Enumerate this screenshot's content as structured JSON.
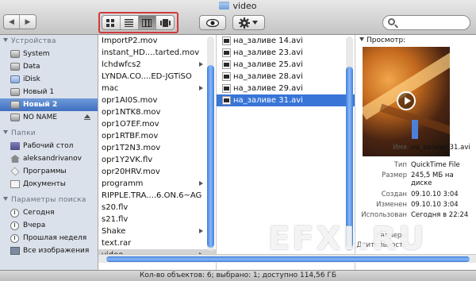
{
  "window": {
    "title": "video"
  },
  "toolbar": {
    "back": "◀",
    "forward": "▶",
    "views": [
      "icon-view",
      "list-view",
      "column-view",
      "coverflow-view"
    ],
    "active_view": "column-view"
  },
  "sidebar": {
    "sections": [
      {
        "title": "Устройства",
        "items": [
          {
            "label": "System",
            "icon": "disk-icon"
          },
          {
            "label": "Data",
            "icon": "disk-icon"
          },
          {
            "label": "iDisk",
            "icon": "idisk-icon"
          },
          {
            "label": "Новый 1",
            "icon": "disk-icon"
          },
          {
            "label": "Новый 2",
            "icon": "disk-icon",
            "selected": true
          },
          {
            "label": "NO NAME",
            "icon": "disk-icon",
            "eject": true
          }
        ]
      },
      {
        "title": "Папки",
        "items": [
          {
            "label": "Рабочий стол",
            "icon": "desktop-icon"
          },
          {
            "label": "aleksandrivanov",
            "icon": "home-icon"
          },
          {
            "label": "Программы",
            "icon": "applications-icon"
          },
          {
            "label": "Документы",
            "icon": "documents-icon"
          }
        ]
      },
      {
        "title": "Параметры поиска",
        "items": [
          {
            "label": "Сегодня",
            "icon": "clock-icon"
          },
          {
            "label": "Вчера",
            "icon": "clock-icon"
          },
          {
            "label": "Прошлая неделя",
            "icon": "clock-icon"
          },
          {
            "label": "Все изображения",
            "icon": "images-icon"
          }
        ]
      }
    ]
  },
  "column1": {
    "rows": [
      {
        "label": "ImportP2.mov"
      },
      {
        "label": "instant_HD....tarted.mov"
      },
      {
        "label": "lchdwfcs2",
        "folder": true
      },
      {
        "label": "LYNDA.CO....ED-JGTiSO"
      },
      {
        "label": "mac",
        "folder": true
      },
      {
        "label": "opr1AI0S.mov"
      },
      {
        "label": "opr1NTK8.mov"
      },
      {
        "label": "opr1O7EF.mov"
      },
      {
        "label": "opr1RTBF.mov"
      },
      {
        "label": "opr1T2N3.mov"
      },
      {
        "label": "opr1Y2VK.flv"
      },
      {
        "label": "opr20HRV.mov"
      },
      {
        "label": "programm",
        "folder": true
      },
      {
        "label": "RIPPLE.TRA....6.ON.6~AG"
      },
      {
        "label": "s20.flv"
      },
      {
        "label": "s21.flv"
      },
      {
        "label": "Shake",
        "folder": true
      },
      {
        "label": "text.rar"
      },
      {
        "label": "video",
        "folder": true,
        "highlight": true
      }
    ]
  },
  "column2": {
    "rows": [
      {
        "label": "на_заливе 14.avi"
      },
      {
        "label": "на_заливе 23.avi"
      },
      {
        "label": "на_заливе 25.avi"
      },
      {
        "label": "на_заливе 28.avi"
      },
      {
        "label": "на_заливе 29.avi"
      },
      {
        "label": "на_заливе 31.avi",
        "selected": true
      }
    ]
  },
  "preview": {
    "heading": "Просмотр:",
    "fields": [
      {
        "key": "Имя",
        "value": "на_заливе 31.avi"
      },
      {
        "key": "Тип",
        "value": "QuickTime File"
      },
      {
        "key": "Размер",
        "value": "245,5 МБ на диске"
      },
      {
        "key": "Создан",
        "value": "09.10.10 3:04"
      },
      {
        "key": "Изменен",
        "value": "09.10.10 3:04"
      },
      {
        "key": "Использован",
        "value": "Сегодня в 22:24"
      },
      {
        "key": "Размеры",
        "value": ""
      },
      {
        "key": "Длительность",
        "value": ""
      }
    ]
  },
  "status": {
    "text": "Кол-во объектов: 6; выбрано: 1; доступно 114,56 ГБ"
  },
  "watermark": {
    "text": "EFXI.RU"
  }
}
